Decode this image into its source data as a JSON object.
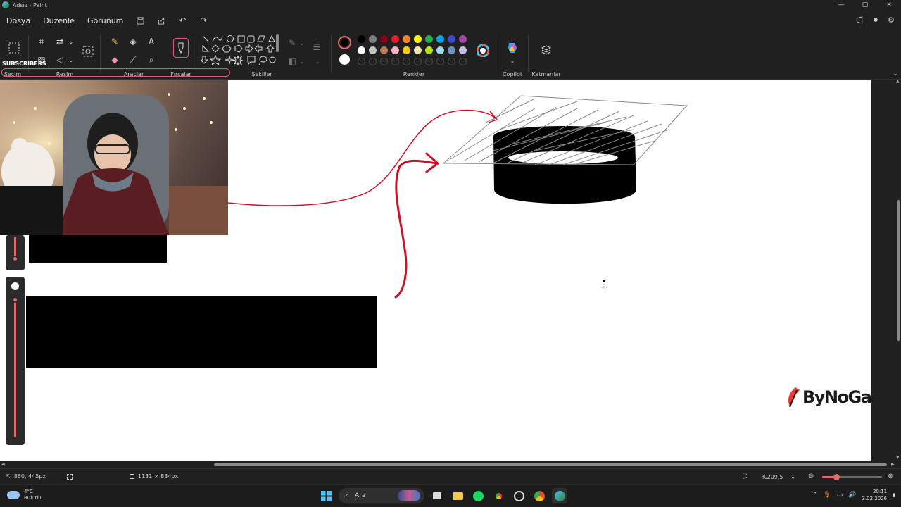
{
  "window": {
    "title": "Adsız - Paint",
    "controls": {
      "minimize": "—",
      "maximize": "▢",
      "close": "✕"
    }
  },
  "menu": {
    "items": [
      "Dosya",
      "Düzenle",
      "Görünüm"
    ],
    "quick_icons": [
      "save-icon",
      "share-icon",
      "undo-icon",
      "redo-icon"
    ],
    "right_icons": [
      "feedback-icon",
      "account-icon",
      "settings-icon"
    ]
  },
  "ribbon": {
    "groups": {
      "selection": "Seçim",
      "image": "Resim",
      "tools": "Araçlar",
      "brushes": "Fırçalar",
      "shapes": "Şekiller",
      "colors": "Renkler",
      "copilot": "Copilot",
      "layers": "Katmanlar"
    },
    "overlay_text": "SUBSCRIBERS",
    "palette_row1": [
      "#000000",
      "#7f7f7f",
      "#880015",
      "#ed1c24",
      "#ff7f27",
      "#fff200",
      "#22b14c",
      "#00a2e8",
      "#3f48cc",
      "#a349a4"
    ],
    "palette_row2": [
      "#ffffff",
      "#c3c3c3",
      "#b97a57",
      "#ffaec9",
      "#ffc90e",
      "#efe4b0",
      "#b5e61d",
      "#99d9ea",
      "#7092be",
      "#c8bfe7"
    ],
    "primary_color": "#000000",
    "secondary_color": "#ffffff"
  },
  "canvas": {
    "stroke_red": "#d0102a",
    "watermark": "ByNoGame"
  },
  "statusbar": {
    "cursor_pos": "860, 445px",
    "canvas_size": "1131 × 834px",
    "zoom": "%209,5",
    "zoom_level": 0.24
  },
  "taskbar": {
    "weather_temp": "4°C",
    "weather_desc": "Bulutlu",
    "search_label": "Ara",
    "time": "20:11",
    "date": "3.02.2026"
  }
}
